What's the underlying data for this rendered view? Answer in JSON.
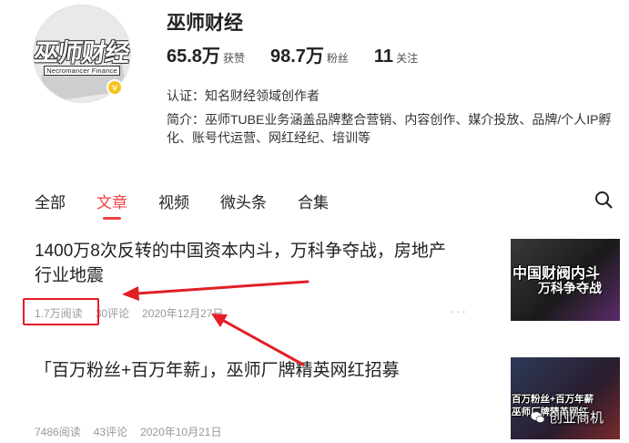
{
  "profile": {
    "name": "巫师财经",
    "avatar_text": "巫师财经",
    "avatar_subtext": "Necromancer Finance",
    "stats": [
      {
        "value": "65.8万",
        "label": "获赞"
      },
      {
        "value": "98.7万",
        "label": "粉丝"
      },
      {
        "value": "11",
        "label": "关注"
      }
    ],
    "verification": "认证：知名财经领域创作者",
    "bio": "简介：巫师TUBE业务涵盖品牌整合营销、内容创作、媒介投放、品牌/个人IP孵化、账号代运营、网红经纪、培训等"
  },
  "tabs": [
    {
      "label": "全部",
      "active": false
    },
    {
      "label": "文章",
      "active": true
    },
    {
      "label": "视频",
      "active": false
    },
    {
      "label": "微头条",
      "active": false
    },
    {
      "label": "合集",
      "active": false
    }
  ],
  "articles": [
    {
      "title_line1": "1400万8次反转的中国资本内斗，万科争夺战，房地产",
      "title_line2": "行业地震",
      "reads": "1.7万阅读",
      "comments": "30评论",
      "date": "2020年12月27日",
      "more": "···",
      "thumb_line1": "中国财阀内斗",
      "thumb_line2": "万科争夺战"
    },
    {
      "title_line1": "「百万粉丝+百万年薪」，巫师厂牌精英网红招募",
      "reads": "7486阅读",
      "comments": "43评论",
      "date": "2020年10月21日",
      "thumb_line1": "百万粉丝+百万年薪",
      "thumb_line2": "巫师厂牌精英网红"
    }
  ],
  "watermark": "创业商机",
  "colors": {
    "accent": "#f04142",
    "annotation": "#e21f26"
  }
}
